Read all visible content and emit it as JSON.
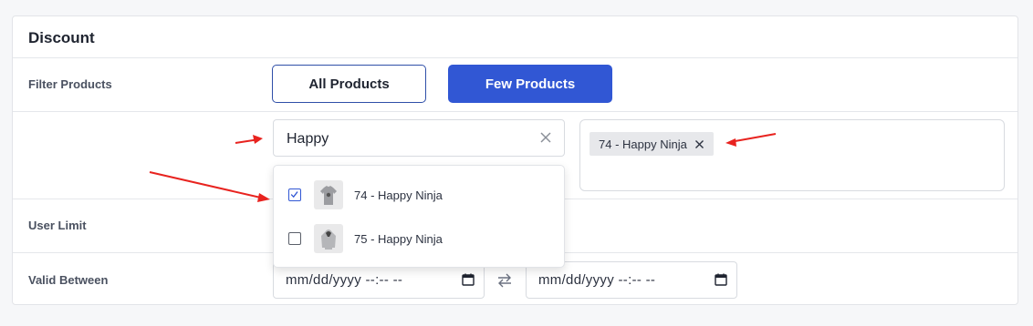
{
  "panel": {
    "title": "Discount"
  },
  "filter": {
    "label": "Filter Products",
    "all_label": "All Products",
    "few_label": "Few Products",
    "active": "Few Products"
  },
  "search": {
    "value": "Happy"
  },
  "dropdown": {
    "options": [
      {
        "label": "74 - Happy Ninja",
        "checked": true,
        "icon": "tshirt-thumbnail"
      },
      {
        "label": "75 - Happy Ninja",
        "checked": false,
        "icon": "hoodie-thumbnail"
      }
    ]
  },
  "selected": {
    "tags": [
      {
        "label": "74 - Happy Ninja"
      }
    ]
  },
  "user_limit": {
    "label": "User Limit"
  },
  "valid_between": {
    "label": "Valid Between",
    "start_placeholder": "mm/dd/yyyy --:-- --",
    "end_placeholder": "mm/dd/yyyy --:-- --"
  },
  "colors": {
    "primary": "#3157d4",
    "outline": "#2f4fa8",
    "annotation_arrow": "#e8231f"
  }
}
